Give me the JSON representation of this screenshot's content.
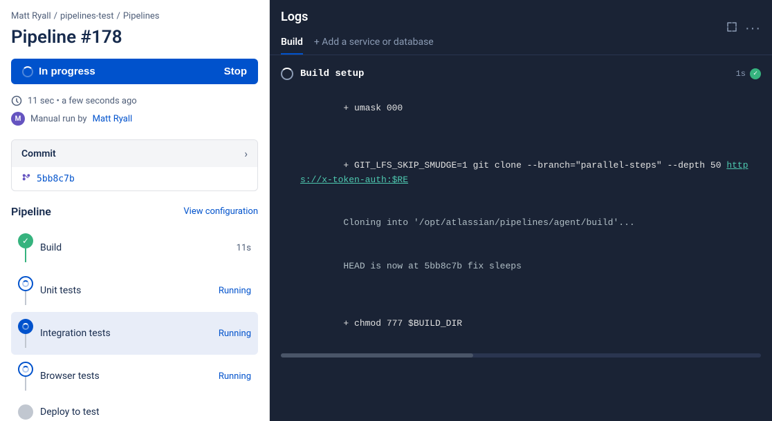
{
  "breadcrumb": {
    "user": "Matt Ryall",
    "sep1": "/",
    "repo": "pipelines-test",
    "sep2": "/",
    "section": "Pipelines"
  },
  "page": {
    "title": "Pipeline #178"
  },
  "status_button": {
    "label": "In progress",
    "stop_label": "Stop"
  },
  "meta": {
    "duration": "11 sec • a few seconds ago",
    "run_by_prefix": "Manual run by",
    "run_by_user": "Matt Ryall"
  },
  "commit": {
    "section_title": "Commit",
    "hash": "5bb8c7b"
  },
  "pipeline": {
    "title": "Pipeline",
    "view_config_label": "View configuration",
    "steps": [
      {
        "name": "Build",
        "status": "11s",
        "state": "success"
      },
      {
        "name": "Unit tests",
        "status": "Running",
        "state": "running-spin"
      },
      {
        "name": "Integration tests",
        "status": "Running",
        "state": "running-blue",
        "active": true
      },
      {
        "name": "Browser tests",
        "status": "Running",
        "state": "running-spin"
      },
      {
        "name": "Deploy to test",
        "status": "",
        "state": "pending"
      }
    ]
  },
  "logs": {
    "title": "Logs",
    "tabs": [
      {
        "label": "Build",
        "active": true
      },
      {
        "label": "+ Add a service or database",
        "active": false
      }
    ],
    "build_setup": {
      "title": "Build setup",
      "duration": "1s",
      "lines": [
        {
          "text": "+ umask 000",
          "type": "cmd"
        },
        {
          "text": "",
          "type": "blank"
        },
        {
          "text": "+ GIT_LFS_SKIP_SMUDGE=1 git clone --branch=\"parallel-steps\" --depth 50 https://x-token-auth:$RE",
          "type": "cmd-trunc"
        },
        {
          "text": "Cloning into '/opt/atlassian/pipelines/agent/build'...",
          "type": "normal"
        },
        {
          "text": "HEAD is now at 5bb8c7b fix sleeps",
          "type": "normal"
        },
        {
          "text": "",
          "type": "blank"
        },
        {
          "text": "+ chmod 777 $BUILD_DIR",
          "type": "cmd"
        }
      ]
    }
  }
}
